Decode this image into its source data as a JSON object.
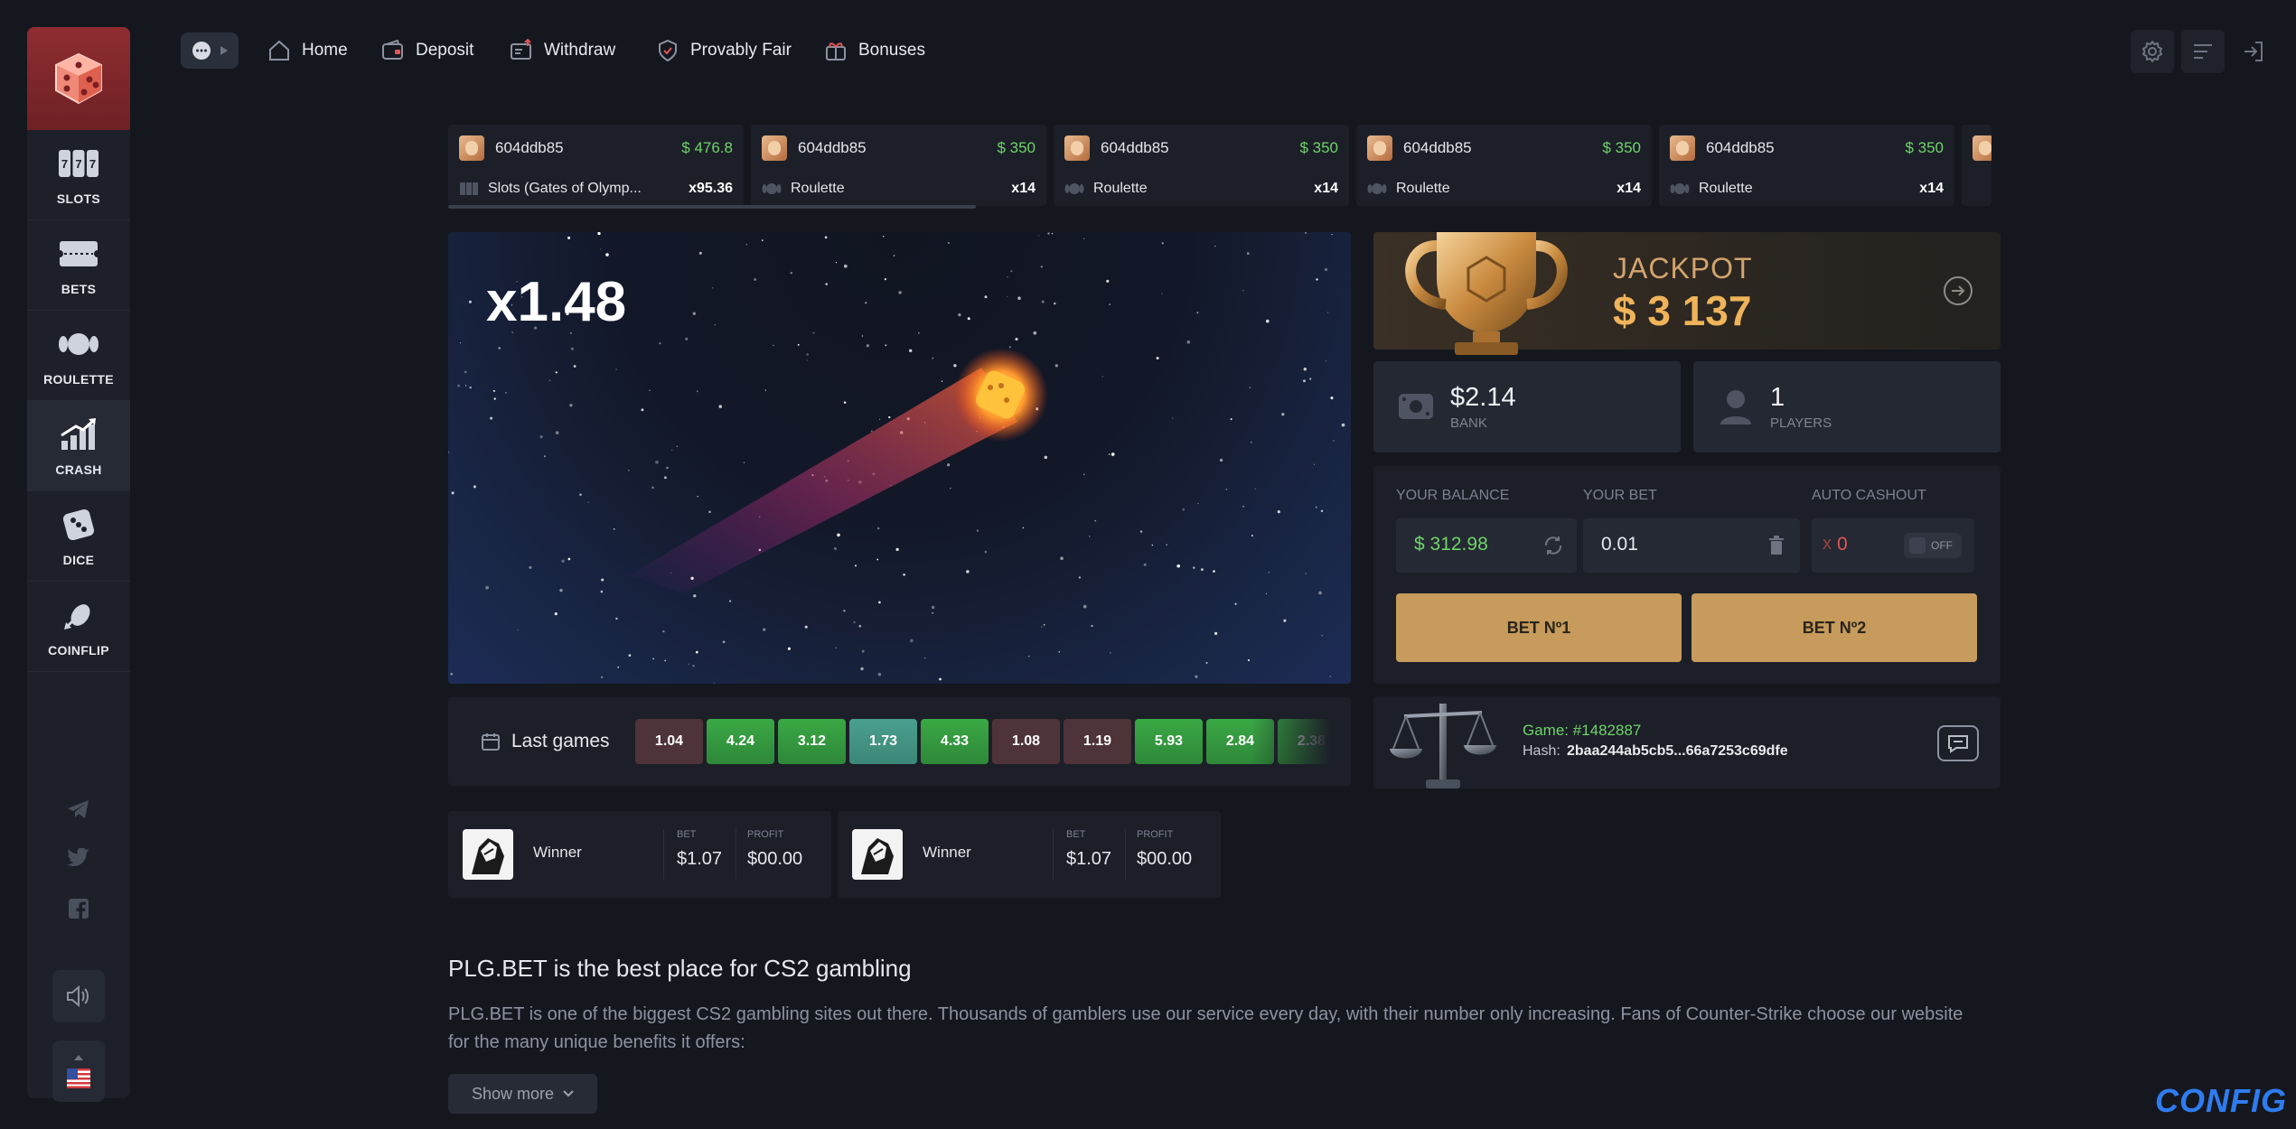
{
  "sidebar": {
    "games": [
      {
        "label": "SLOTS",
        "icon": "slots-icon"
      },
      {
        "label": "BETS",
        "icon": "ticket-icon"
      },
      {
        "label": "ROULETTE",
        "icon": "roulette-icon"
      },
      {
        "label": "CRASH",
        "icon": "crash-icon"
      },
      {
        "label": "DICE",
        "icon": "dice-icon"
      },
      {
        "label": "COINFLIP",
        "icon": "coinflip-icon"
      }
    ],
    "active": "CRASH",
    "social": [
      "telegram-icon",
      "twitter-icon",
      "facebook-icon"
    ]
  },
  "header": {
    "nav": [
      {
        "label": "Home",
        "icon": "home-icon"
      },
      {
        "label": "Deposit",
        "icon": "wallet-icon"
      },
      {
        "label": "Withdraw",
        "icon": "withdraw-icon"
      },
      {
        "label": "Provably Fair",
        "icon": "shield-icon"
      },
      {
        "label": "Bonuses",
        "icon": "gift-icon"
      }
    ]
  },
  "ticker": [
    {
      "user": "604ddb85",
      "amount": "$ 476.8",
      "game": "Slots (Gates of Olymp...",
      "mult": "x95.36"
    },
    {
      "user": "604ddb85",
      "amount": "$ 350",
      "game": "Roulette",
      "mult": "x14"
    },
    {
      "user": "604ddb85",
      "amount": "$ 350",
      "game": "Roulette",
      "mult": "x14"
    },
    {
      "user": "604ddb85",
      "amount": "$ 350",
      "game": "Roulette",
      "mult": "x14"
    },
    {
      "user": "604ddb85",
      "amount": "$ 350",
      "game": "Roulette",
      "mult": "x14"
    }
  ],
  "ticker_scroll_fraction": 0.34,
  "crash": {
    "multiplier": "x1.48"
  },
  "last_games": {
    "label": "Last games",
    "values": [
      {
        "v": "1.04",
        "c": "red"
      },
      {
        "v": "4.24",
        "c": "green"
      },
      {
        "v": "3.12",
        "c": "green"
      },
      {
        "v": "1.73",
        "c": "teal"
      },
      {
        "v": "4.33",
        "c": "green"
      },
      {
        "v": "1.08",
        "c": "red"
      },
      {
        "v": "1.19",
        "c": "red"
      },
      {
        "v": "5.93",
        "c": "green"
      },
      {
        "v": "2.84",
        "c": "green"
      },
      {
        "v": "2.38",
        "c": "green"
      }
    ]
  },
  "winners": [
    {
      "name": "Winner",
      "bet_label": "BET",
      "bet": "$1.07",
      "profit_label": "PROFIT",
      "profit": "$00.00"
    },
    {
      "name": "Winner",
      "bet_label": "BET",
      "bet": "$1.07",
      "profit_label": "PROFIT",
      "profit": "$00.00"
    }
  ],
  "seo": {
    "title": "PLG.BET is the best place for CS2 gambling",
    "text": "PLG.BET is one of the biggest CS2 gambling sites out there. Thousands of gamblers use our service every day, with their number only increasing. Fans of Counter-Strike choose our website for the many unique benefits it offers:",
    "show_more": "Show more"
  },
  "jackpot": {
    "label": "JACKPOT",
    "value": "$ 3 137"
  },
  "stats": {
    "bank": {
      "value": "$2.14",
      "label": "BANK"
    },
    "players": {
      "value": "1",
      "label": "PLAYERS"
    }
  },
  "bet_panel": {
    "balance_label": "YOUR BALANCE",
    "balance": "$ 312.98",
    "bet_label": "YOUR BET",
    "bet": "0.01",
    "auto_label": "AUTO CASHOUT",
    "auto_prefix": "x",
    "auto_value": "0",
    "auto_toggle": "OFF",
    "bet1": "BET Nº1",
    "bet2": "BET Nº2"
  },
  "fair": {
    "game": "Game: #1482887",
    "hash_label": "Hash:",
    "hash": "2baa244ab5cb5...66a7253c69dfe"
  },
  "watermark": "CONFIG",
  "colors": {
    "accent_gold": "#c69b5c",
    "green": "#6fd36a",
    "red": "#e05656",
    "logo_red": "#8f2d31"
  }
}
